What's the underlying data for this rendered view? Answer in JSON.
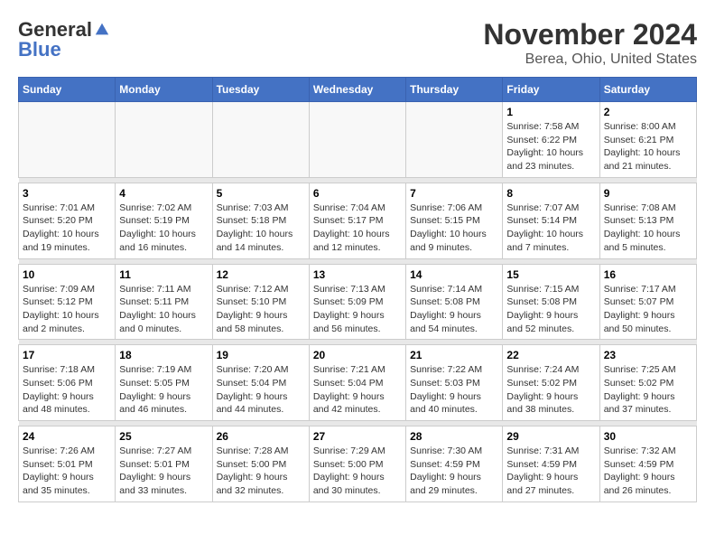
{
  "header": {
    "logo_general": "General",
    "logo_blue": "Blue",
    "month": "November 2024",
    "location": "Berea, Ohio, United States"
  },
  "weekdays": [
    "Sunday",
    "Monday",
    "Tuesday",
    "Wednesday",
    "Thursday",
    "Friday",
    "Saturday"
  ],
  "weeks": [
    [
      {
        "day": "",
        "info": ""
      },
      {
        "day": "",
        "info": ""
      },
      {
        "day": "",
        "info": ""
      },
      {
        "day": "",
        "info": ""
      },
      {
        "day": "",
        "info": ""
      },
      {
        "day": "1",
        "info": "Sunrise: 7:58 AM\nSunset: 6:22 PM\nDaylight: 10 hours\nand 23 minutes."
      },
      {
        "day": "2",
        "info": "Sunrise: 8:00 AM\nSunset: 6:21 PM\nDaylight: 10 hours\nand 21 minutes."
      }
    ],
    [
      {
        "day": "3",
        "info": "Sunrise: 7:01 AM\nSunset: 5:20 PM\nDaylight: 10 hours\nand 19 minutes."
      },
      {
        "day": "4",
        "info": "Sunrise: 7:02 AM\nSunset: 5:19 PM\nDaylight: 10 hours\nand 16 minutes."
      },
      {
        "day": "5",
        "info": "Sunrise: 7:03 AM\nSunset: 5:18 PM\nDaylight: 10 hours\nand 14 minutes."
      },
      {
        "day": "6",
        "info": "Sunrise: 7:04 AM\nSunset: 5:17 PM\nDaylight: 10 hours\nand 12 minutes."
      },
      {
        "day": "7",
        "info": "Sunrise: 7:06 AM\nSunset: 5:15 PM\nDaylight: 10 hours\nand 9 minutes."
      },
      {
        "day": "8",
        "info": "Sunrise: 7:07 AM\nSunset: 5:14 PM\nDaylight: 10 hours\nand 7 minutes."
      },
      {
        "day": "9",
        "info": "Sunrise: 7:08 AM\nSunset: 5:13 PM\nDaylight: 10 hours\nand 5 minutes."
      }
    ],
    [
      {
        "day": "10",
        "info": "Sunrise: 7:09 AM\nSunset: 5:12 PM\nDaylight: 10 hours\nand 2 minutes."
      },
      {
        "day": "11",
        "info": "Sunrise: 7:11 AM\nSunset: 5:11 PM\nDaylight: 10 hours\nand 0 minutes."
      },
      {
        "day": "12",
        "info": "Sunrise: 7:12 AM\nSunset: 5:10 PM\nDaylight: 9 hours\nand 58 minutes."
      },
      {
        "day": "13",
        "info": "Sunrise: 7:13 AM\nSunset: 5:09 PM\nDaylight: 9 hours\nand 56 minutes."
      },
      {
        "day": "14",
        "info": "Sunrise: 7:14 AM\nSunset: 5:08 PM\nDaylight: 9 hours\nand 54 minutes."
      },
      {
        "day": "15",
        "info": "Sunrise: 7:15 AM\nSunset: 5:08 PM\nDaylight: 9 hours\nand 52 minutes."
      },
      {
        "day": "16",
        "info": "Sunrise: 7:17 AM\nSunset: 5:07 PM\nDaylight: 9 hours\nand 50 minutes."
      }
    ],
    [
      {
        "day": "17",
        "info": "Sunrise: 7:18 AM\nSunset: 5:06 PM\nDaylight: 9 hours\nand 48 minutes."
      },
      {
        "day": "18",
        "info": "Sunrise: 7:19 AM\nSunset: 5:05 PM\nDaylight: 9 hours\nand 46 minutes."
      },
      {
        "day": "19",
        "info": "Sunrise: 7:20 AM\nSunset: 5:04 PM\nDaylight: 9 hours\nand 44 minutes."
      },
      {
        "day": "20",
        "info": "Sunrise: 7:21 AM\nSunset: 5:04 PM\nDaylight: 9 hours\nand 42 minutes."
      },
      {
        "day": "21",
        "info": "Sunrise: 7:22 AM\nSunset: 5:03 PM\nDaylight: 9 hours\nand 40 minutes."
      },
      {
        "day": "22",
        "info": "Sunrise: 7:24 AM\nSunset: 5:02 PM\nDaylight: 9 hours\nand 38 minutes."
      },
      {
        "day": "23",
        "info": "Sunrise: 7:25 AM\nSunset: 5:02 PM\nDaylight: 9 hours\nand 37 minutes."
      }
    ],
    [
      {
        "day": "24",
        "info": "Sunrise: 7:26 AM\nSunset: 5:01 PM\nDaylight: 9 hours\nand 35 minutes."
      },
      {
        "day": "25",
        "info": "Sunrise: 7:27 AM\nSunset: 5:01 PM\nDaylight: 9 hours\nand 33 minutes."
      },
      {
        "day": "26",
        "info": "Sunrise: 7:28 AM\nSunset: 5:00 PM\nDaylight: 9 hours\nand 32 minutes."
      },
      {
        "day": "27",
        "info": "Sunrise: 7:29 AM\nSunset: 5:00 PM\nDaylight: 9 hours\nand 30 minutes."
      },
      {
        "day": "28",
        "info": "Sunrise: 7:30 AM\nSunset: 4:59 PM\nDaylight: 9 hours\nand 29 minutes."
      },
      {
        "day": "29",
        "info": "Sunrise: 7:31 AM\nSunset: 4:59 PM\nDaylight: 9 hours\nand 27 minutes."
      },
      {
        "day": "30",
        "info": "Sunrise: 7:32 AM\nSunset: 4:59 PM\nDaylight: 9 hours\nand 26 minutes."
      }
    ]
  ]
}
